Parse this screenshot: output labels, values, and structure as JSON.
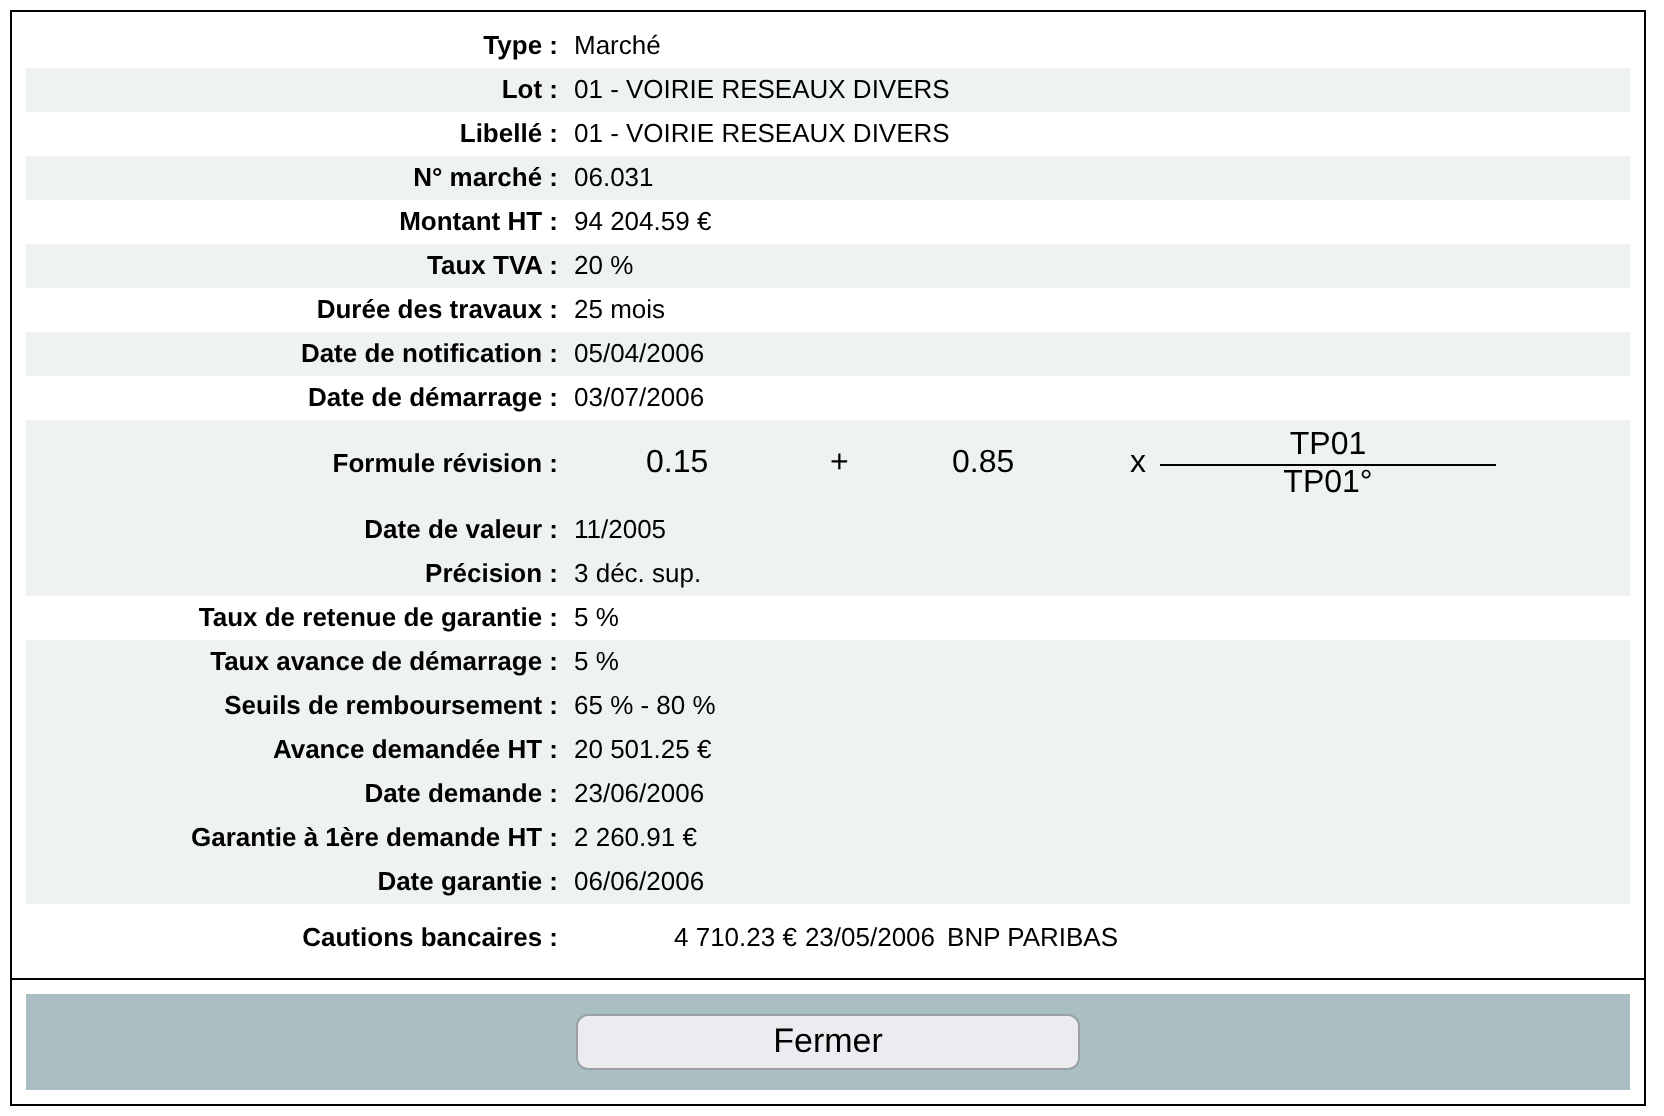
{
  "rows": [
    {
      "kind": "field",
      "label": "Type :",
      "value": "Marché",
      "shaded": false
    },
    {
      "kind": "field",
      "label": "Lot :",
      "value": "01 - VOIRIE RESEAUX DIVERS",
      "shaded": true
    },
    {
      "kind": "field",
      "label": "Libellé :",
      "value": "01 - VOIRIE RESEAUX DIVERS",
      "shaded": false
    },
    {
      "kind": "field",
      "label": "N° marché :",
      "value": "06.031",
      "shaded": true
    },
    {
      "kind": "field",
      "label": "Montant HT :",
      "value": "94 204.59 €",
      "shaded": false
    },
    {
      "kind": "field",
      "label": "Taux TVA :",
      "value": "20 %",
      "shaded": true
    },
    {
      "kind": "field",
      "label": "Durée des travaux :",
      "value": "25 mois",
      "shaded": false
    },
    {
      "kind": "field",
      "label": "Date de notification :",
      "value": "05/04/2006",
      "shaded": true
    },
    {
      "kind": "field",
      "label": "Date de démarrage :",
      "value": "03/07/2006",
      "shaded": false
    },
    {
      "kind": "formula",
      "label": "Formule révision :",
      "fixed": "0.15",
      "plus": "+",
      "variable": "0.85",
      "times": "x",
      "numerator": "TP01",
      "denominator": "TP01°",
      "shaded": true
    },
    {
      "kind": "field",
      "label": "Date de valeur :",
      "value": "11/2005",
      "shaded": true
    },
    {
      "kind": "field",
      "label": "Précision :",
      "value": "3 déc. sup.",
      "shaded": true
    },
    {
      "kind": "field",
      "label": "Taux de retenue de garantie :",
      "value": "5 %",
      "shaded": false
    },
    {
      "kind": "field",
      "label": "Taux avance de démarrage :",
      "value": "5 %",
      "shaded": true
    },
    {
      "kind": "field",
      "label": "Seuils de remboursement :",
      "value": "65 % - 80 %",
      "shaded": true
    },
    {
      "kind": "field",
      "label": "Avance demandée HT :",
      "value": "20 501.25 €",
      "shaded": true
    },
    {
      "kind": "field",
      "label": "Date demande :",
      "value": "23/06/2006",
      "shaded": true
    },
    {
      "kind": "field",
      "label": "Garantie à 1ère demande HT :",
      "value": "2 260.91 €",
      "shaded": true
    },
    {
      "kind": "field",
      "label": "Date garantie :",
      "value": "06/06/2006",
      "shaded": true
    },
    {
      "kind": "cautions",
      "label": "Cautions bancaires :",
      "amount": "4 710.23 €",
      "date": "23/05/2006",
      "bank": "BNP PARIBAS",
      "shaded": false
    }
  ],
  "close_button": "Fermer"
}
